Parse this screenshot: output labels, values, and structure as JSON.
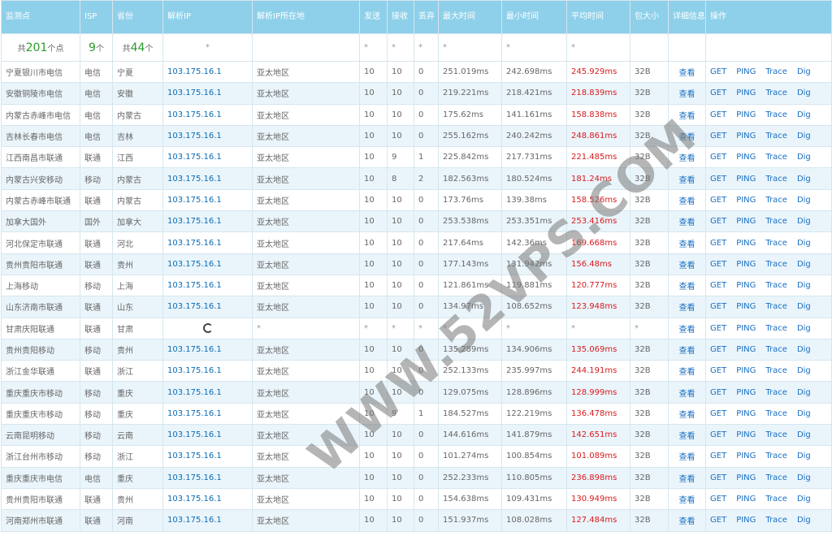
{
  "headers": [
    "监测点",
    "ISP",
    "省份",
    "解析IP",
    "解析IP所在地",
    "发送",
    "接收",
    "丢弃",
    "最大时间",
    "最小时间",
    "平均时间",
    "包大小",
    "详细信息",
    "操作"
  ],
  "summary": {
    "points_prefix": "共",
    "points_count": "201",
    "points_suffix": "个点",
    "isp_count": "9",
    "isp_suffix": "个",
    "prov_prefix": "共",
    "prov_count": "44",
    "prov_suffix": "个",
    "dash": "*"
  },
  "actions": {
    "view": "查看",
    "get": "GET",
    "ping": "PING",
    "trace": "Trace",
    "dig": "Dig"
  },
  "rows": [
    {
      "site": "宁夏银川市电信",
      "isp": "电信",
      "prov": "宁夏",
      "ip": "103.175.16.1",
      "loc": "亚太地区",
      "sent": "10",
      "recv": "10",
      "drop": "0",
      "max": "251.019ms",
      "min": "242.698ms",
      "avg": "245.929ms",
      "size": "32B"
    },
    {
      "site": "安徽铜陵市电信",
      "isp": "电信",
      "prov": "安徽",
      "ip": "103.175.16.1",
      "loc": "亚太地区",
      "sent": "10",
      "recv": "10",
      "drop": "0",
      "max": "219.221ms",
      "min": "218.421ms",
      "avg": "218.839ms",
      "size": "32B"
    },
    {
      "site": "内蒙古赤峰市电信",
      "isp": "电信",
      "prov": "内蒙古",
      "ip": "103.175.16.1",
      "loc": "亚太地区",
      "sent": "10",
      "recv": "10",
      "drop": "0",
      "max": "175.62ms",
      "min": "141.161ms",
      "avg": "158.838ms",
      "size": "32B"
    },
    {
      "site": "吉林长春市电信",
      "isp": "电信",
      "prov": "吉林",
      "ip": "103.175.16.1",
      "loc": "亚太地区",
      "sent": "10",
      "recv": "10",
      "drop": "0",
      "max": "255.162ms",
      "min": "240.242ms",
      "avg": "248.861ms",
      "size": "32B"
    },
    {
      "site": "江西南昌市联通",
      "isp": "联通",
      "prov": "江西",
      "ip": "103.175.16.1",
      "loc": "亚太地区",
      "sent": "10",
      "recv": "9",
      "drop": "1",
      "max": "225.842ms",
      "min": "217.731ms",
      "avg": "221.485ms",
      "size": "32B"
    },
    {
      "site": "内蒙古兴安移动",
      "isp": "移动",
      "prov": "内蒙古",
      "ip": "103.175.16.1",
      "loc": "亚太地区",
      "sent": "10",
      "recv": "8",
      "drop": "2",
      "max": "182.563ms",
      "min": "180.524ms",
      "avg": "181.24ms",
      "size": "32B"
    },
    {
      "site": "内蒙古赤峰市联通",
      "isp": "联通",
      "prov": "内蒙古",
      "ip": "103.175.16.1",
      "loc": "亚太地区",
      "sent": "10",
      "recv": "10",
      "drop": "0",
      "max": "173.76ms",
      "min": "139.38ms",
      "avg": "158.526ms",
      "size": "32B"
    },
    {
      "site": "加拿大国外",
      "isp": "国外",
      "prov": "加拿大",
      "ip": "103.175.16.1",
      "loc": "亚太地区",
      "sent": "10",
      "recv": "10",
      "drop": "0",
      "max": "253.538ms",
      "min": "253.351ms",
      "avg": "253.416ms",
      "size": "32B"
    },
    {
      "site": "河北保定市联通",
      "isp": "联通",
      "prov": "河北",
      "ip": "103.175.16.1",
      "loc": "亚太地区",
      "sent": "10",
      "recv": "10",
      "drop": "0",
      "max": "217.64ms",
      "min": "142.36ms",
      "avg": "169.668ms",
      "size": "32B"
    },
    {
      "site": "贵州贵阳市联通",
      "isp": "联通",
      "prov": "贵州",
      "ip": "103.175.16.1",
      "loc": "亚太地区",
      "sent": "10",
      "recv": "10",
      "drop": "0",
      "max": "177.143ms",
      "min": "131.942ms",
      "avg": "156.48ms",
      "size": "32B"
    },
    {
      "site": "上海移动",
      "isp": "移动",
      "prov": "上海",
      "ip": "103.175.16.1",
      "loc": "亚太地区",
      "sent": "10",
      "recv": "10",
      "drop": "0",
      "max": "121.861ms",
      "min": "119.881ms",
      "avg": "120.777ms",
      "size": "32B"
    },
    {
      "site": "山东济南市联通",
      "isp": "联通",
      "prov": "山东",
      "ip": "103.175.16.1",
      "loc": "亚太地区",
      "sent": "10",
      "recv": "10",
      "drop": "0",
      "max": "134.97ms",
      "min": "108.652ms",
      "avg": "123.948ms",
      "size": "32B"
    },
    {
      "site": "甘肃庆阳联通",
      "isp": "联通",
      "prov": "甘肃",
      "ip": "",
      "loc": "*",
      "sent": "*",
      "recv": "*",
      "drop": "*",
      "max": "*",
      "min": "*",
      "avg": "*",
      "size": "*",
      "loading": true
    },
    {
      "site": "贵州贵阳移动",
      "isp": "移动",
      "prov": "贵州",
      "ip": "103.175.16.1",
      "loc": "亚太地区",
      "sent": "10",
      "recv": "10",
      "drop": "0",
      "max": "135.289ms",
      "min": "134.906ms",
      "avg": "135.069ms",
      "size": "32B"
    },
    {
      "site": "浙江金华联通",
      "isp": "联通",
      "prov": "浙江",
      "ip": "103.175.16.1",
      "loc": "亚太地区",
      "sent": "10",
      "recv": "10",
      "drop": "0",
      "max": "252.133ms",
      "min": "235.997ms",
      "avg": "244.191ms",
      "size": "32B"
    },
    {
      "site": "重庆重庆市移动",
      "isp": "移动",
      "prov": "重庆",
      "ip": "103.175.16.1",
      "loc": "亚太地区",
      "sent": "10",
      "recv": "10",
      "drop": "0",
      "max": "129.075ms",
      "min": "128.896ms",
      "avg": "128.999ms",
      "size": "32B"
    },
    {
      "site": "重庆重庆市移动",
      "isp": "移动",
      "prov": "重庆",
      "ip": "103.175.16.1",
      "loc": "亚太地区",
      "sent": "10",
      "recv": "9",
      "drop": "1",
      "max": "184.527ms",
      "min": "122.219ms",
      "avg": "136.478ms",
      "size": "32B"
    },
    {
      "site": "云南昆明移动",
      "isp": "移动",
      "prov": "云南",
      "ip": "103.175.16.1",
      "loc": "亚太地区",
      "sent": "10",
      "recv": "10",
      "drop": "0",
      "max": "144.616ms",
      "min": "141.879ms",
      "avg": "142.651ms",
      "size": "32B"
    },
    {
      "site": "浙江台州市移动",
      "isp": "移动",
      "prov": "浙江",
      "ip": "103.175.16.1",
      "loc": "亚太地区",
      "sent": "10",
      "recv": "10",
      "drop": "0",
      "max": "101.274ms",
      "min": "100.854ms",
      "avg": "101.089ms",
      "size": "32B"
    },
    {
      "site": "重庆重庆市电信",
      "isp": "电信",
      "prov": "重庆",
      "ip": "103.175.16.1",
      "loc": "亚太地区",
      "sent": "10",
      "recv": "10",
      "drop": "0",
      "max": "252.233ms",
      "min": "110.805ms",
      "avg": "236.898ms",
      "size": "32B"
    },
    {
      "site": "贵州贵阳市联通",
      "isp": "联通",
      "prov": "贵州",
      "ip": "103.175.16.1",
      "loc": "亚太地区",
      "sent": "10",
      "recv": "10",
      "drop": "0",
      "max": "154.638ms",
      "min": "109.431ms",
      "avg": "130.949ms",
      "size": "32B"
    },
    {
      "site": "河南郑州市联通",
      "isp": "联通",
      "prov": "河南",
      "ip": "103.175.16.1",
      "loc": "亚太地区",
      "sent": "10",
      "recv": "10",
      "drop": "0",
      "max": "151.937ms",
      "min": "108.028ms",
      "avg": "127.484ms",
      "size": "32B"
    }
  ],
  "watermark": "WWW.52VPS.COM"
}
